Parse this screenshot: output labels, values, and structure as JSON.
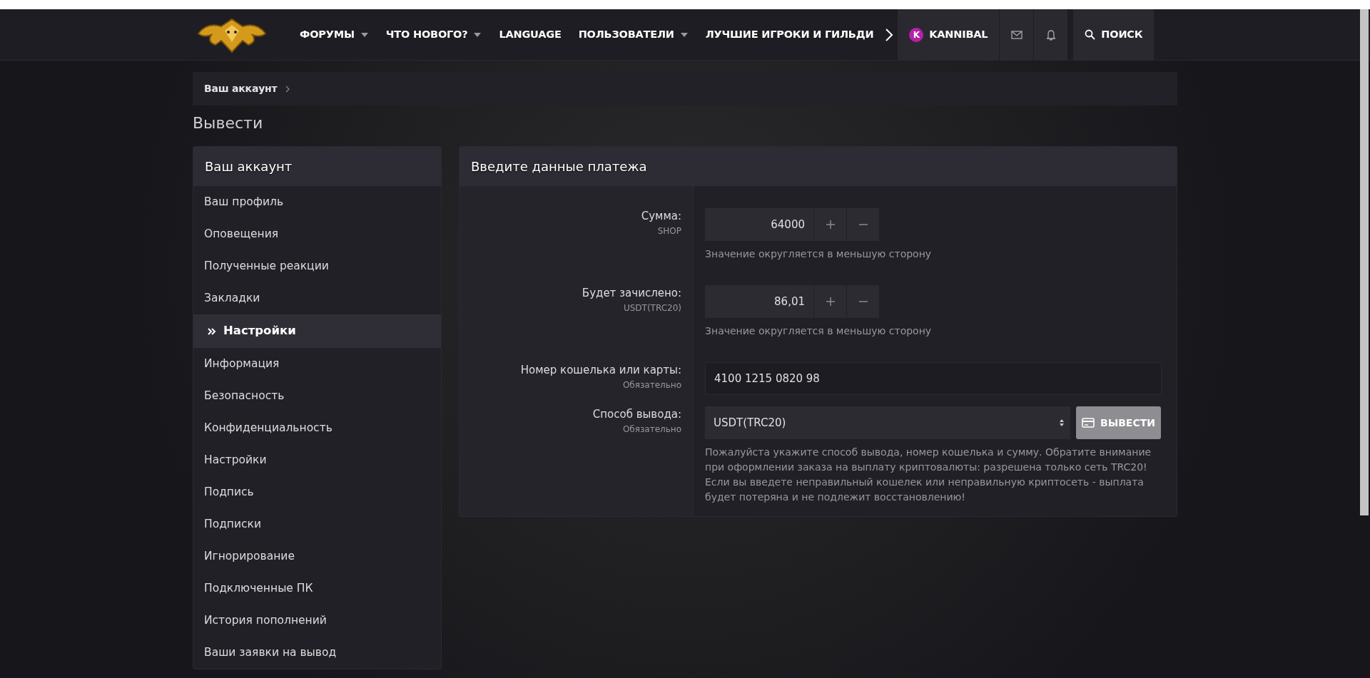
{
  "nav": {
    "items": [
      {
        "label": "ФОРУМЫ",
        "has_menu": true
      },
      {
        "label": "ЧТО НОВОГО?",
        "has_menu": true
      },
      {
        "label": "LANGUAGE",
        "has_menu": false
      },
      {
        "label": "ПОЛЬЗОВАТЕЛИ",
        "has_menu": true
      },
      {
        "label": "ЛУЧШИЕ ИГРОКИ И ГИЛЬДИ",
        "has_menu": false
      }
    ],
    "user": {
      "avatar_letter": "K",
      "name": "KANNIBAL"
    },
    "search_label": "ПОИСК"
  },
  "breadcrumb": [
    {
      "label": "Ваш аккаунт"
    }
  ],
  "page_title": "Вывести",
  "sidebar": {
    "title": "Ваш аккаунт",
    "items": [
      {
        "label": "Ваш профиль",
        "selected": false
      },
      {
        "label": "Оповещения",
        "selected": false
      },
      {
        "label": "Полученные реакции",
        "selected": false
      },
      {
        "label": "Закладки",
        "selected": false
      },
      {
        "label": "Настройки",
        "selected": true
      },
      {
        "label": "Информация",
        "selected": false
      },
      {
        "label": "Безопасность",
        "selected": false
      },
      {
        "label": "Конфиденциальность",
        "selected": false
      },
      {
        "label": "Настройки",
        "selected": false
      },
      {
        "label": "Подпись",
        "selected": false
      },
      {
        "label": "Подписки",
        "selected": false
      },
      {
        "label": "Игнорирование",
        "selected": false
      },
      {
        "label": "Подключенные ПК",
        "selected": false
      },
      {
        "label": "История пополнений",
        "selected": false
      },
      {
        "label": "Ваши заявки на вывод",
        "selected": false
      }
    ]
  },
  "form": {
    "title": "Введите данные платежа",
    "rows": [
      {
        "kind": "stepper",
        "label": "Сумма:",
        "hint": "SHOP",
        "value": "64000",
        "explain": "Значение округляется в меньшую сторону"
      },
      {
        "kind": "stepper",
        "label": "Будет зачислено:",
        "hint": "USDT(TRC20)",
        "value": "86,01",
        "explain": "Значение округляется в меньшую сторону"
      },
      {
        "kind": "text",
        "label": "Номер кошелька или карты:",
        "hint": "Обязательно",
        "value": "4100 1215 0820 98"
      },
      {
        "kind": "select",
        "label": "Способ вывода:",
        "hint": "Обязательно",
        "value": "USDT(TRC20)",
        "button": "ВЫВЕСТИ",
        "explain": "Пожалуйста укажите способ вывода, номер кошелька и сумму. Обратите внимание при оформлении заказа на выплату криптовалюты: разрешена только сеть TRC20! Если вы введете неправильный кошелек или неправильную криптосеть - выплата будет потеряна и не подлежит восстановлению!"
      }
    ]
  }
}
